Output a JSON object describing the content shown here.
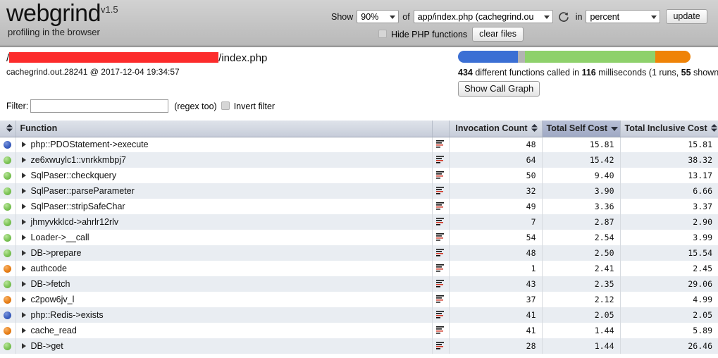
{
  "brand": {
    "name": "webgrind",
    "version": "v1.5",
    "tagline": "profiling in the browser"
  },
  "toolbar": {
    "show_label": "Show",
    "percentage": "90%",
    "of_label": "of",
    "file": "app/index.php (cachegrind.ou",
    "refresh_icon": "refresh-icon",
    "in_label": "in",
    "format": "percent",
    "update_label": "update",
    "hide_php_label": "Hide PHP functions",
    "clear_files_label": "clear files"
  },
  "info": {
    "path_prefix": "/",
    "path_redacted": "",
    "path_suffix": "/index.php",
    "file_line": "cachegrind.out.28241 @ 2017-12-04 19:34:57"
  },
  "summary": {
    "bar_segments": [
      {
        "name": "php-internal",
        "color": "#3b6fd4",
        "width_pct": 25.8
      },
      {
        "name": "unknown",
        "color": "#b3b3b3",
        "width_pct": 3.0
      },
      {
        "name": "procedural",
        "color": "#8ed16b",
        "width_pct": 56.1
      },
      {
        "name": "class-method",
        "color": "#ef8307",
        "width_pct": 15.1
      }
    ],
    "function_count": "434",
    "text_part1": " different functions called in ",
    "milliseconds": "116",
    "text_part2": " milliseconds (1 runs, ",
    "shown_count": "55",
    "text_part3": " shown)",
    "call_graph_label": "Show Call Graph"
  },
  "filter": {
    "label": "Filter:",
    "value": "",
    "placeholder": "",
    "note": "(regex too)",
    "invert_label": "Invert filter"
  },
  "table": {
    "headers": {
      "mark": "",
      "function": "Function",
      "icon": "",
      "invocation_count": "Invocation Count",
      "total_self_cost": "Total Self Cost",
      "total_inclusive_cost": "Total Inclusive Cost"
    },
    "sorted_column": "total_self_cost",
    "sort_direction": "desc",
    "rows": [
      {
        "dot": "blue",
        "function": "php::PDOStatement->execute",
        "invocations": "48",
        "self": "15.81",
        "inclusive": "15.81"
      },
      {
        "dot": "green",
        "function": "ze6xwuylc1::vnrkkmbpj7",
        "invocations": "64",
        "self": "15.42",
        "inclusive": "38.32"
      },
      {
        "dot": "green",
        "function": "SqlPaser::checkquery",
        "invocations": "50",
        "self": "9.40",
        "inclusive": "13.17"
      },
      {
        "dot": "green",
        "function": "SqlPaser::parseParameter",
        "invocations": "32",
        "self": "3.90",
        "inclusive": "6.66"
      },
      {
        "dot": "green",
        "function": "SqlPaser::stripSafeChar",
        "invocations": "49",
        "self": "3.36",
        "inclusive": "3.37"
      },
      {
        "dot": "green",
        "function": "jhmyvkklcd->ahrlr12rlv",
        "invocations": "7",
        "self": "2.87",
        "inclusive": "2.90"
      },
      {
        "dot": "green",
        "function": "Loader->__call",
        "invocations": "54",
        "self": "2.54",
        "inclusive": "3.99"
      },
      {
        "dot": "green",
        "function": "DB->prepare",
        "invocations": "48",
        "self": "2.50",
        "inclusive": "15.54"
      },
      {
        "dot": "orange",
        "function": "authcode",
        "invocations": "1",
        "self": "2.41",
        "inclusive": "2.45"
      },
      {
        "dot": "green",
        "function": "DB->fetch",
        "invocations": "43",
        "self": "2.35",
        "inclusive": "29.06"
      },
      {
        "dot": "orange",
        "function": "c2pow6jv_l",
        "invocations": "37",
        "self": "2.12",
        "inclusive": "4.99"
      },
      {
        "dot": "blue",
        "function": "php::Redis->exists",
        "invocations": "41",
        "self": "2.05",
        "inclusive": "2.05"
      },
      {
        "dot": "orange",
        "function": "cache_read",
        "invocations": "41",
        "self": "1.44",
        "inclusive": "5.89"
      },
      {
        "dot": "green",
        "function": "DB->get",
        "invocations": "28",
        "self": "1.44",
        "inclusive": "26.46"
      }
    ]
  }
}
